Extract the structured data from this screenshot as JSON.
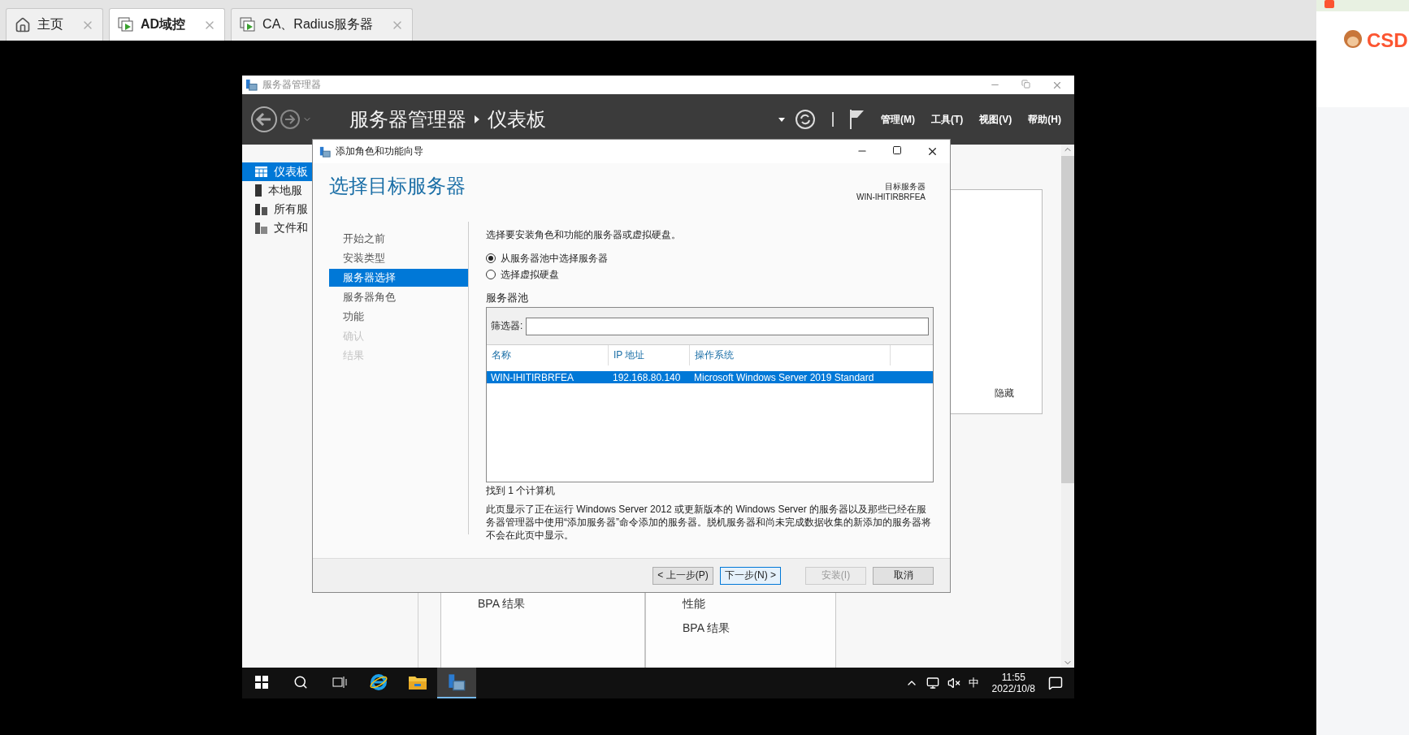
{
  "browser_tabs": [
    {
      "kind": "home",
      "label": "主页",
      "selected": false
    },
    {
      "kind": "vm",
      "label": "AD域控",
      "selected": true
    },
    {
      "kind": "vm",
      "label": "CA、Radius服务器",
      "selected": false
    }
  ],
  "side_panel": {
    "logo": "CSD"
  },
  "server_manager": {
    "title": "服务器管理器",
    "breadcrumb": [
      "服务器管理器",
      "仪表板"
    ],
    "menus": [
      "管理(M)",
      "工具(T)",
      "视图(V)",
      "帮助(H)"
    ],
    "sidebar": [
      {
        "kind": "dashboard",
        "label": "仪表板",
        "selected": true
      },
      {
        "kind": "server",
        "label": "本地服",
        "selected": false
      },
      {
        "kind": "servers",
        "label": "所有服",
        "selected": false
      },
      {
        "kind": "files",
        "label": "文件和",
        "selected": false
      }
    ],
    "welcome_panel": {
      "hide_link": "隐藏"
    },
    "cards": [
      {
        "items": [
          "BPA 结果"
        ]
      },
      {
        "items": [
          "性能",
          "BPA 结果"
        ]
      }
    ]
  },
  "wizard": {
    "title": "添加角色和功能向导",
    "heading": "选择目标服务器",
    "target_label": "目标服务器",
    "target_server": "WIN-IHITIRBRFEA",
    "steps": [
      {
        "label": "开始之前",
        "selected": false,
        "disabled": false
      },
      {
        "label": "安装类型",
        "selected": false,
        "disabled": false
      },
      {
        "label": "服务器选择",
        "selected": true,
        "disabled": false
      },
      {
        "label": "服务器角色",
        "selected": false,
        "disabled": false
      },
      {
        "label": "功能",
        "selected": false,
        "disabled": false
      },
      {
        "label": "确认",
        "selected": false,
        "disabled": true
      },
      {
        "label": "结果",
        "selected": false,
        "disabled": true
      }
    ],
    "instruction": "选择要安装角色和功能的服务器或虚拟硬盘。",
    "options": [
      {
        "label": "从服务器池中选择服务器",
        "selected": true
      },
      {
        "label": "选择虚拟硬盘",
        "selected": false
      }
    ],
    "pool_label": "服务器池",
    "filter_label": "筛选器:",
    "columns": [
      "名称",
      "IP 地址",
      "操作系统"
    ],
    "rows": [
      {
        "cells": [
          "WIN-IHITIRBRFEA",
          "192.168.80.140",
          "Microsoft Windows Server 2019 Standard"
        ],
        "selected": true
      }
    ],
    "count": "找到 1 个计算机",
    "note": "此页显示了正在运行 Windows Server 2012 或更新版本的 Windows Server 的服务器以及那些已经在服务器管理器中使用“添加服务器”命令添加的服务器。脱机服务器和尚未完成数据收集的新添加的服务器将不会在此页中显示。",
    "buttons": [
      {
        "label": "< 上一步(P)",
        "disabled": false,
        "focused": false
      },
      {
        "label": "下一步(N) >",
        "disabled": false,
        "focused": true
      },
      {
        "label": "安装(I)",
        "disabled": true,
        "focused": false
      },
      {
        "label": "取消",
        "disabled": false,
        "focused": false
      }
    ]
  },
  "taskbar": {
    "apps": [
      {
        "kind": "start",
        "active": false
      },
      {
        "kind": "search",
        "active": false
      },
      {
        "kind": "taskview",
        "active": false
      },
      {
        "kind": "browser",
        "active": false
      },
      {
        "kind": "folder",
        "active": false
      },
      {
        "kind": "servermanager",
        "active": true
      }
    ],
    "ime": "中",
    "time": "11:55",
    "date": "2022/10/8"
  }
}
